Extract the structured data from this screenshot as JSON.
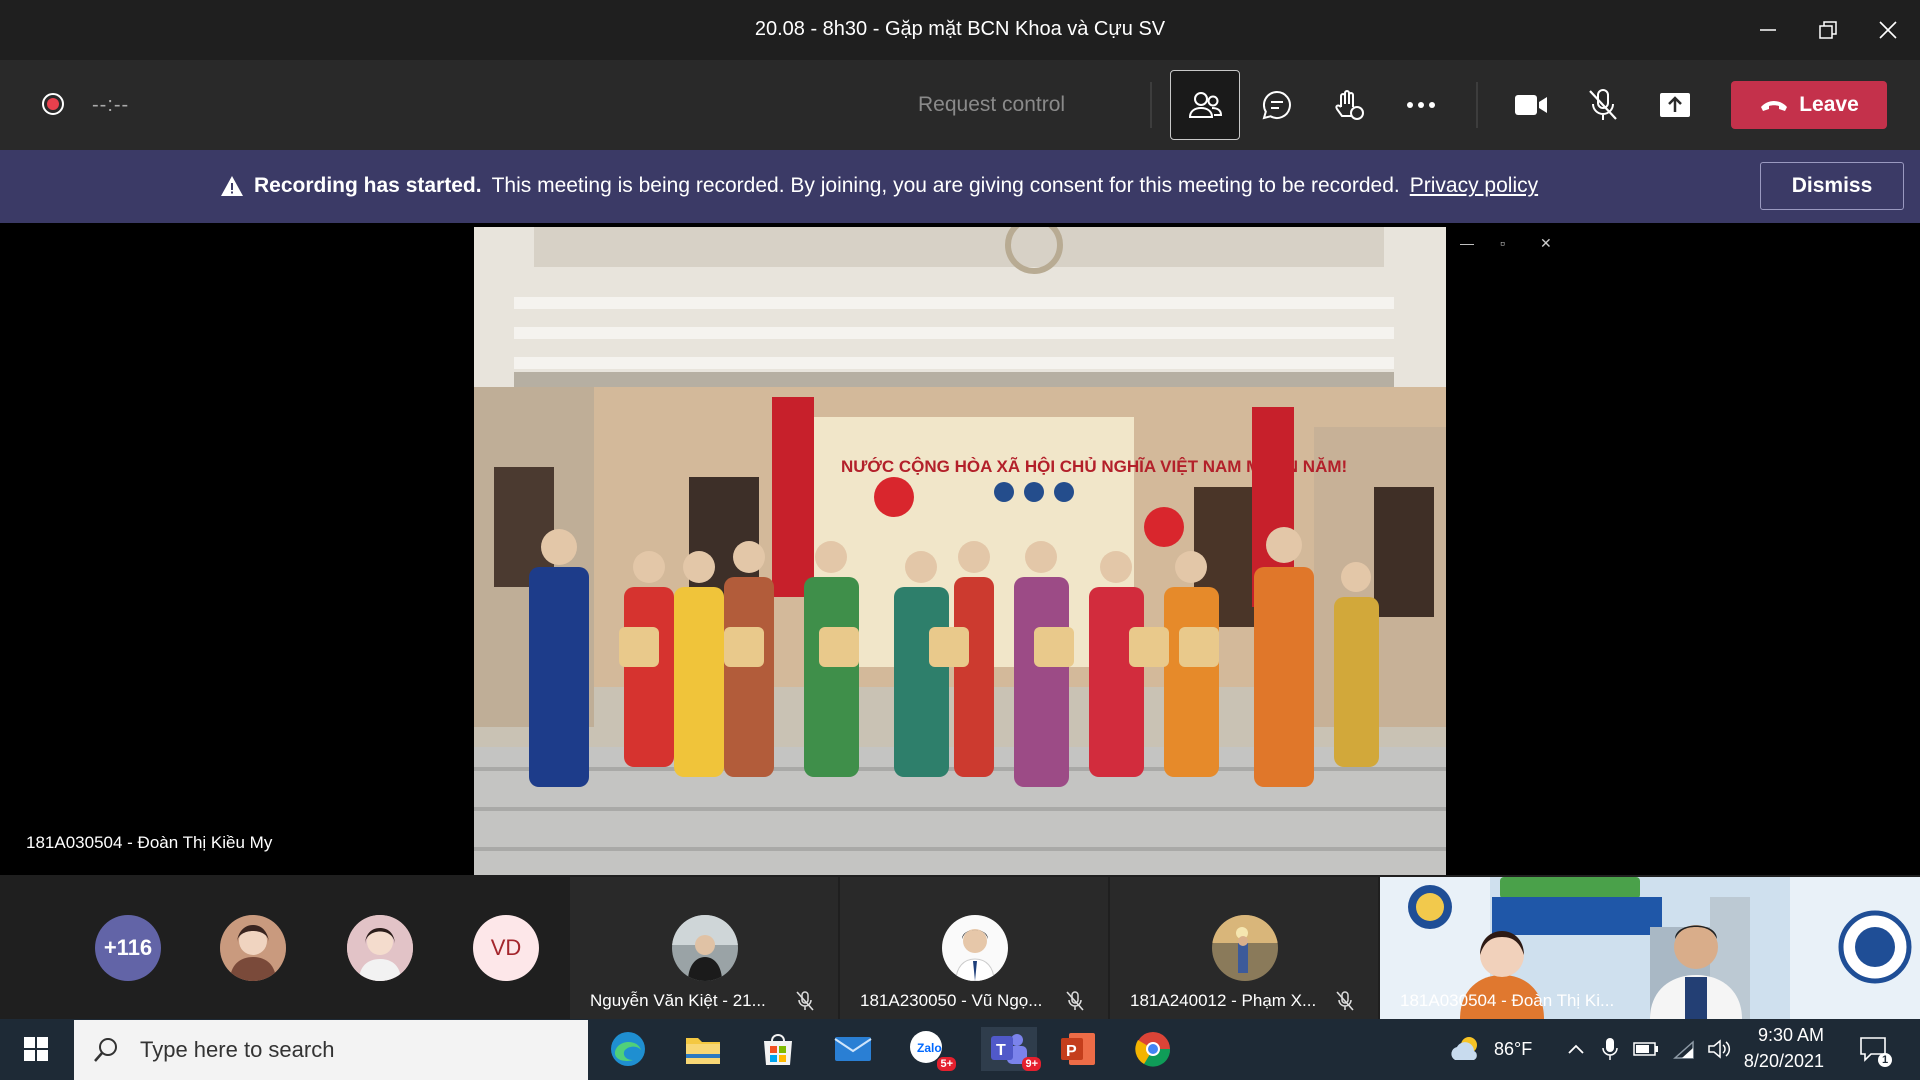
{
  "window": {
    "title": "20.08 - 8h30 - Gặp mặt BCN Khoa và Cựu SV"
  },
  "toolbar": {
    "timer": "--:--",
    "request_control": "Request control",
    "leave_label": "Leave"
  },
  "banner": {
    "bold_text": "Recording has started.",
    "message": "This meeting is being recorded. By joining, you are giving consent for this meeting to be recorded.",
    "link": "Privacy policy",
    "dismiss_label": "Dismiss"
  },
  "stage": {
    "speaker_name": "181A030504 - Đoàn Thị Kiều My",
    "video_sign_text": "NƯỚC CỘNG HÒA XÃ HỘI CHỦ NGHĨA VIỆT NAM MUÔN NĂM!"
  },
  "participants": {
    "overflow_count": "+116",
    "initials_avatar": "VD",
    "tiles": [
      {
        "name": "Nguyễn Văn Kiệt - 21..."
      },
      {
        "name": "181A230050 - Vũ Ngọ..."
      },
      {
        "name": "181A240012 - Phạm X..."
      },
      {
        "name": "181A030504 - Đoàn Thị Ki..."
      }
    ]
  },
  "taskbar": {
    "search_placeholder": "Type here to search",
    "weather": "86°F",
    "time": "9:30 AM",
    "date": "8/20/2021",
    "zalo_badge": "5+",
    "teams_badge": "9+",
    "notification_count": "1"
  },
  "colors": {
    "leave": "#c4314b",
    "banner": "#3b3a66",
    "avatar_overflow": "#6264a7",
    "initials_avatar_bg": "#fde7e9",
    "initials_avatar_fg": "#a4262c"
  }
}
